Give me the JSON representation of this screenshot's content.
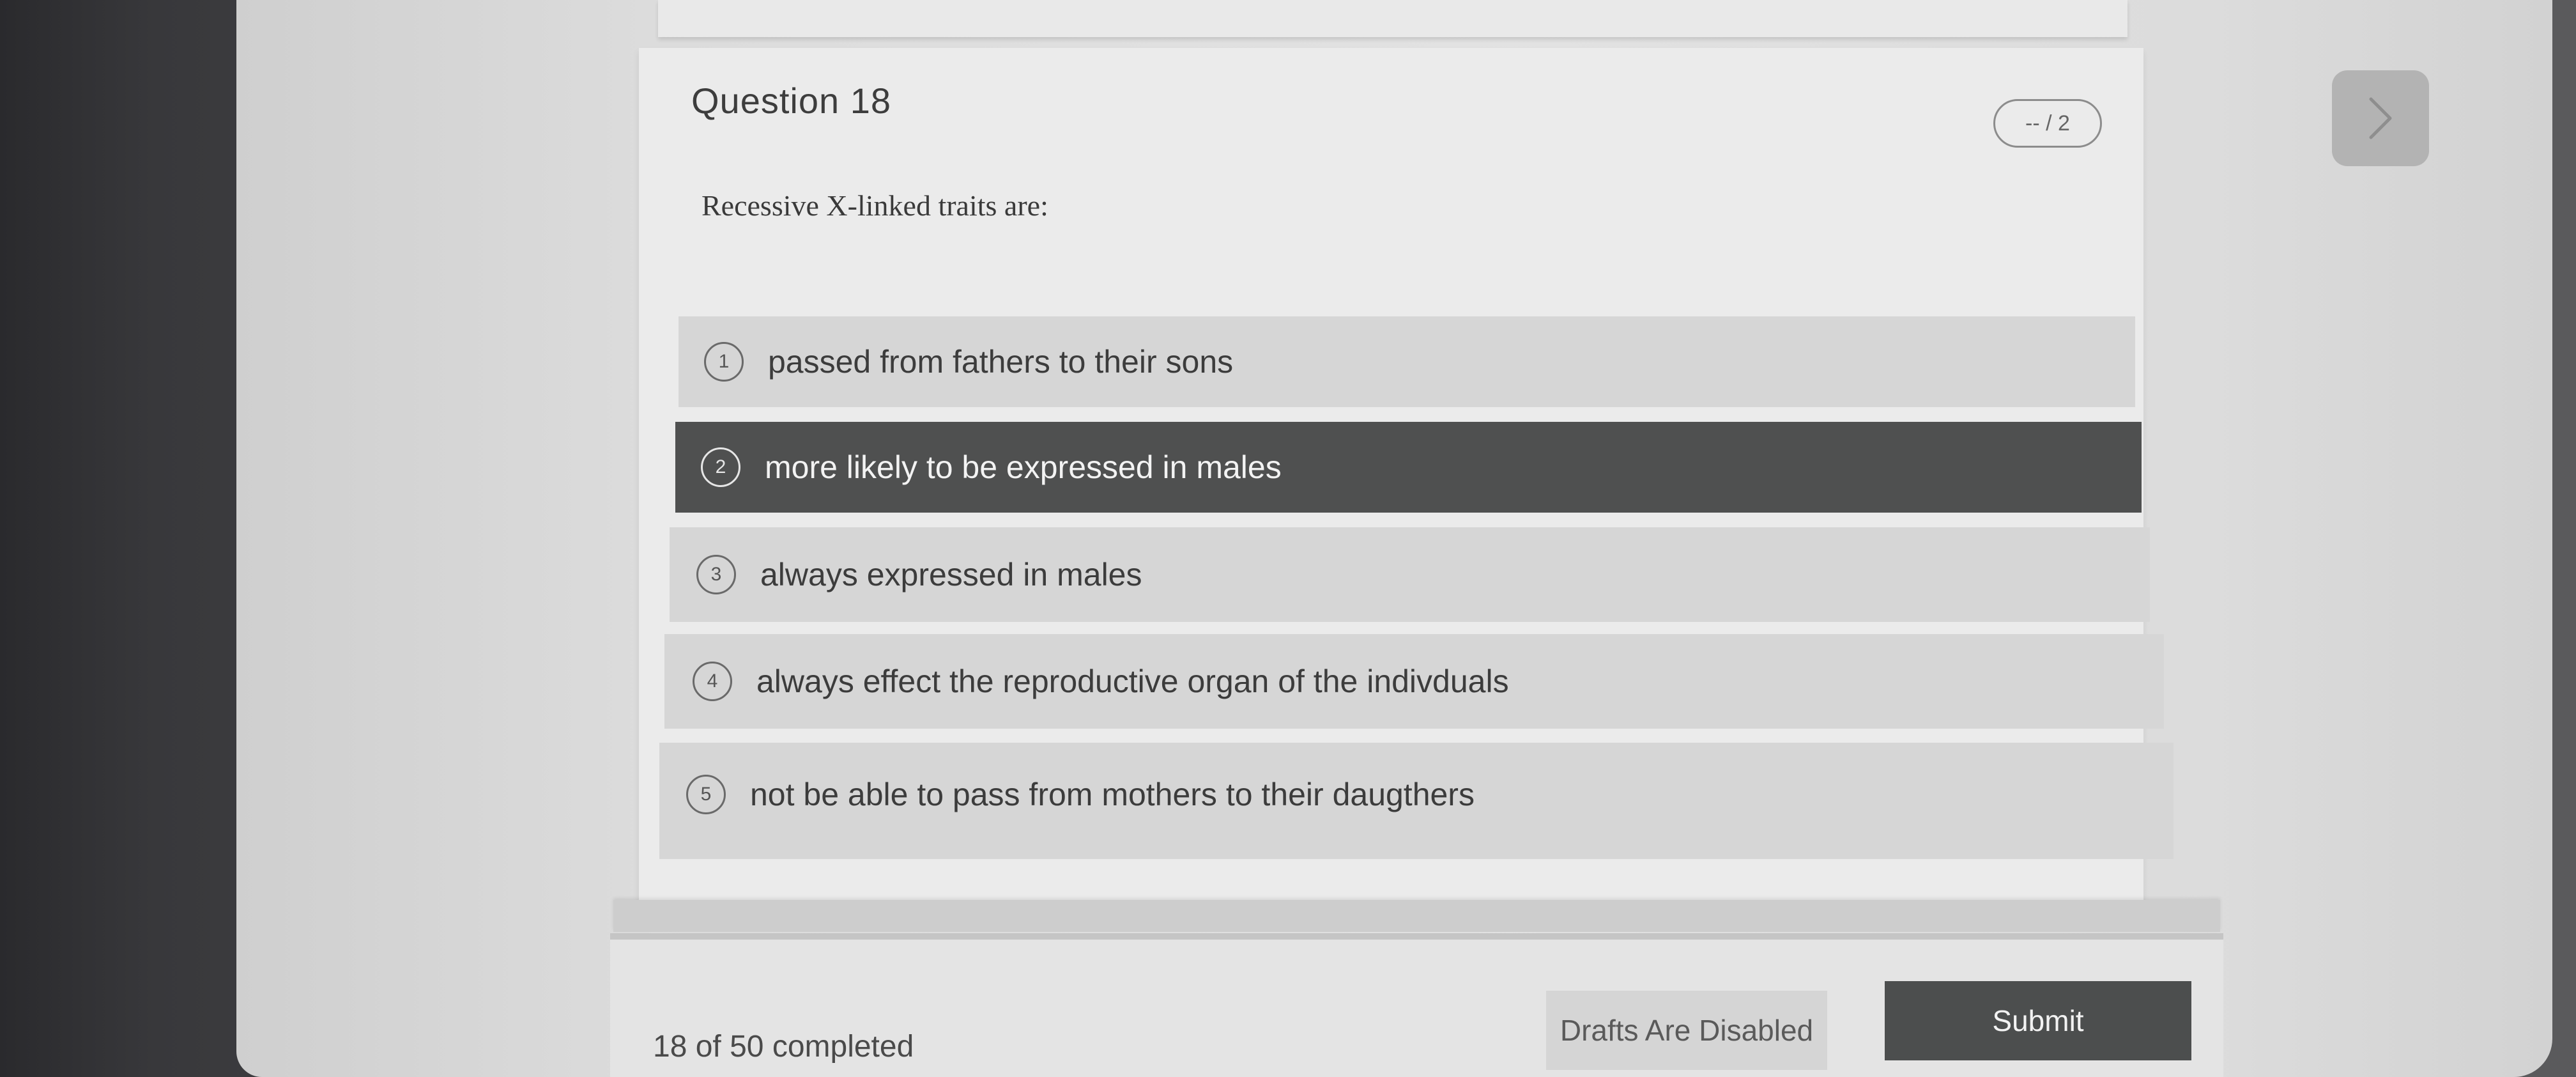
{
  "question": {
    "title": "Question 18",
    "score": "-- / 2",
    "prompt": "Recessive X-linked traits are:"
  },
  "options": [
    {
      "number": "1",
      "text": "passed from fathers to their sons",
      "selected": false
    },
    {
      "number": "2",
      "text": "more likely to be expressed in males",
      "selected": true
    },
    {
      "number": "3",
      "text": "always expressed in males",
      "selected": false
    },
    {
      "number": "4",
      "text": "always effect the reproductive organ of the indivduals",
      "selected": false
    },
    {
      "number": "5",
      "text": "not be able to pass from mothers to their daugthers",
      "selected": false
    }
  ],
  "footer": {
    "progress": "18 of 50 completed",
    "drafts_label": "Drafts Are Disabled",
    "submit_label": "Submit"
  },
  "icons": {
    "next": "chevron-right-icon"
  },
  "colors": {
    "selected_option": "#4f5050",
    "option": "#d6d6d6",
    "submit": "#4c4e4e"
  }
}
